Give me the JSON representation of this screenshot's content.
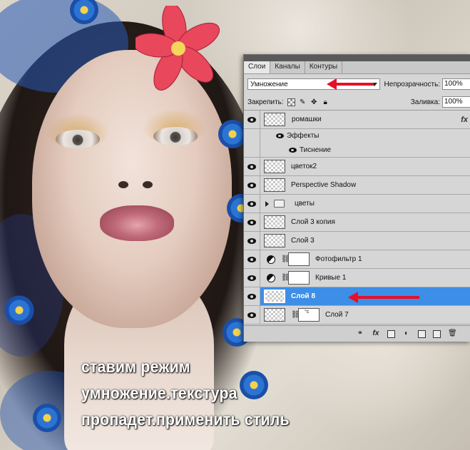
{
  "caption": {
    "line1": "ставим режим",
    "line2": "умножение.текстура",
    "line3": "пропадет.применить стиль"
  },
  "panel": {
    "tabs": [
      {
        "label": "Слои",
        "active": true
      },
      {
        "label": "Каналы",
        "active": false
      },
      {
        "label": "Контуры",
        "active": false
      }
    ],
    "blend_mode": "Умножение",
    "opacity_label": "Непрозрачность:",
    "opacity_value": "100%",
    "lock_label": "Закрепить:",
    "fill_label": "Заливка:",
    "fill_value": "100%",
    "layers": [
      {
        "name": "ромашки",
        "visible": true,
        "fx": "fx"
      },
      {
        "name": "Эффекты",
        "sub": true
      },
      {
        "name": "Тиснение",
        "sub": true
      },
      {
        "name": "цветок2",
        "visible": true
      },
      {
        "name": "Perspective Shadow",
        "visible": true
      },
      {
        "name": "цветы",
        "visible": true,
        "group": true
      },
      {
        "name": "Слой 3 копия",
        "visible": true
      },
      {
        "name": "Слой 3",
        "visible": true
      },
      {
        "name": "Фотофильтр 1",
        "visible": true,
        "adjustment": true
      },
      {
        "name": "Кривые 1",
        "visible": true,
        "adjustment": true
      },
      {
        "name": "Слой 8",
        "visible": true,
        "selected": true
      },
      {
        "name": "Слой 7",
        "visible": true,
        "mask": true
      }
    ]
  },
  "colors": {
    "selection": "#3d8ee6",
    "arrow": "#e4102a"
  },
  "icons": [
    "eye-icon",
    "fx-icon",
    "chain-icon",
    "folder-icon",
    "adjustment-icon",
    "link-icon",
    "add-style-icon",
    "add-mask-icon",
    "new-adjustment-icon",
    "new-group-icon",
    "new-layer-icon",
    "trash-icon",
    "lock-transparent-icon",
    "lock-paint-icon",
    "lock-move-icon",
    "lock-all-icon"
  ]
}
